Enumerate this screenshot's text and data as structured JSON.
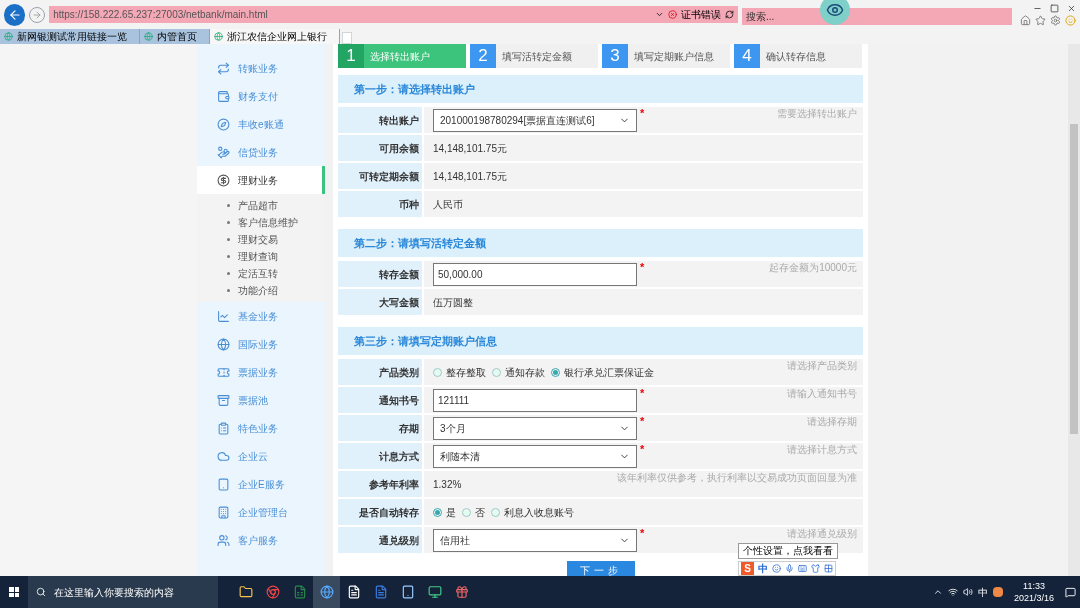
{
  "browser": {
    "url": "https://158.222.65.237:27003/netbank/main.html",
    "cert_error": "证书错误",
    "search_placeholder": "搜索...",
    "tabs": [
      {
        "label": "新网银测试常用链接一览",
        "selected": false
      },
      {
        "label": "内管首页",
        "selected": false
      },
      {
        "label": "浙江农信企业网上银行",
        "selected": true
      }
    ]
  },
  "sidebar": {
    "items": [
      {
        "label": "转账业务",
        "selected": false
      },
      {
        "label": "财务支付",
        "selected": false
      },
      {
        "label": "丰收e账通",
        "selected": false
      },
      {
        "label": "信贷业务",
        "selected": false
      },
      {
        "label": "理财业务",
        "selected": true,
        "children": [
          {
            "label": "产品超市"
          },
          {
            "label": "客户信息维护"
          },
          {
            "label": "理财交易"
          },
          {
            "label": "理财查询"
          },
          {
            "label": "定活互转"
          },
          {
            "label": "功能介绍"
          }
        ]
      },
      {
        "label": "基金业务",
        "selected": false
      },
      {
        "label": "国际业务",
        "selected": false
      },
      {
        "label": "票据业务",
        "selected": false
      },
      {
        "label": "票据池",
        "selected": false
      },
      {
        "label": "特色业务",
        "selected": false
      },
      {
        "label": "企业云",
        "selected": false
      },
      {
        "label": "企业E服务",
        "selected": false
      },
      {
        "label": "企业管理台",
        "selected": false
      },
      {
        "label": "客户服务",
        "selected": false
      }
    ]
  },
  "required_mark": "*",
  "steps": [
    {
      "number": "1",
      "label": "选择转出账户",
      "selected": true
    },
    {
      "number": "2",
      "label": "填写活转定金额",
      "selected": false
    },
    {
      "number": "3",
      "label": "填写定期账户信息",
      "selected": false
    },
    {
      "number": "4",
      "label": "确认转存信息",
      "selected": false
    }
  ],
  "sections": [
    {
      "title": "第一步：请选择转出账户",
      "rows": [
        {
          "kind": "select",
          "label": "转出账户",
          "value": "201000198780294[票据直连测试6]",
          "required": true,
          "hint": "需要选择转出账户"
        },
        {
          "kind": "text",
          "label": "可用余额",
          "value": "14,148,101.75元"
        },
        {
          "kind": "text",
          "label": "可转定期余额",
          "value": "14,148,101.75元"
        },
        {
          "kind": "text",
          "label": "币种",
          "value": "人民币"
        }
      ]
    },
    {
      "title": "第二步：请填写活转定金额",
      "rows": [
        {
          "kind": "input",
          "label": "转存金额",
          "value": "50,000.00",
          "required": true,
          "hint": "起存金额为10000元"
        },
        {
          "kind": "text",
          "label": "大写金额",
          "value": "伍万圆整"
        }
      ]
    },
    {
      "title": "第三步：请填写定期账户信息",
      "rows": [
        {
          "kind": "radio",
          "label": "产品类别",
          "options": [
            {
              "label": "整存整取",
              "selected": false
            },
            {
              "label": "通知存款",
              "selected": false
            },
            {
              "label": "银行承兑汇票保证金",
              "selected": true
            }
          ],
          "hint": "请选择产品类别"
        },
        {
          "kind": "input",
          "label": "通知书号",
          "value": "121111",
          "required": true,
          "hint": "请输入通知书号"
        },
        {
          "kind": "select",
          "label": "存期",
          "value": "3个月",
          "required": true,
          "hint": "请选择存期"
        },
        {
          "kind": "select",
          "label": "计息方式",
          "value": "利随本清",
          "required": true,
          "hint": "请选择计息方式"
        },
        {
          "kind": "text",
          "label": "参考年利率",
          "value": "1.32%",
          "hint": "该年利率仅供参考，执行利率以交易成功页面回显为准"
        },
        {
          "kind": "radio",
          "label": "是否自动转存",
          "options": [
            {
              "label": "是",
              "selected": true
            },
            {
              "label": "否",
              "selected": false
            },
            {
              "label": "利息入收息账号",
              "selected": false
            }
          ]
        },
        {
          "kind": "select",
          "label": "通兑级别",
          "value": "信用社",
          "required": true,
          "hint": "请选择通兑级别"
        }
      ]
    }
  ],
  "next_button": "下一步",
  "ime": {
    "tooltip": "个性设置，点我看看",
    "logo": "S",
    "mode": "中"
  },
  "taskbar": {
    "search_placeholder": "在这里输入你要搜索的内容",
    "ime": "中",
    "time": "11:33",
    "date": "2021/3/16"
  }
}
